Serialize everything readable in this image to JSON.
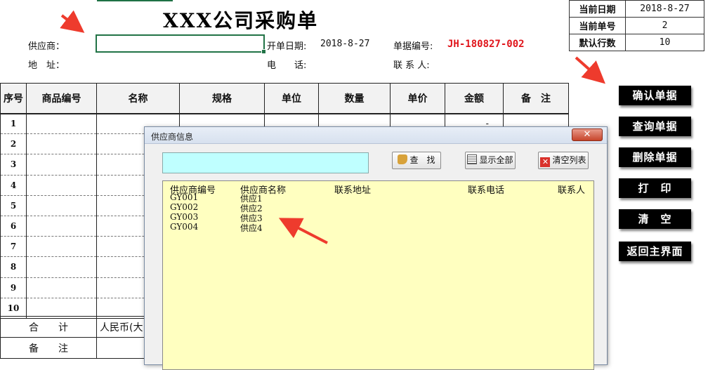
{
  "title": "XXX公司采购单",
  "header": {
    "supplier_label": "供应商：",
    "address_label": "地　址：",
    "open_date_label": "开单日期:",
    "open_date_value": "2018-8-27",
    "order_no_label": "单据编号:",
    "order_no_value": "JH-180827-002",
    "phone_label": "电　　话:",
    "contact_label": "联 系 人:"
  },
  "info_box": [
    {
      "key": "当前日期",
      "value": "2018-8-27"
    },
    {
      "key": "当前单号",
      "value": "2"
    },
    {
      "key": "默认行数",
      "value": "10"
    }
  ],
  "table": {
    "headers": [
      "序号",
      "商品编号",
      "名称",
      "规格",
      "单位",
      "数量",
      "单价",
      "金额",
      "备　注"
    ],
    "rows": [
      "1",
      "2",
      "3",
      "4",
      "5",
      "6",
      "7",
      "8",
      "9",
      "10"
    ],
    "first_amount": "-",
    "total_label": "合　　计",
    "total_value": "人民币(大",
    "remark_label": "备　　注"
  },
  "buttons": [
    "确认单据",
    "查询单据",
    "删除单据",
    "打　印",
    "清　空",
    "返回主界面"
  ],
  "dialog": {
    "title": "供应商信息",
    "search_button": "查　找",
    "show_all_button": "显示全部",
    "clear_list_button": "清空列表",
    "columns": [
      "供应商编号",
      "供应商名称",
      "联系地址",
      "联系电话",
      "联系人"
    ],
    "rows": [
      {
        "code": "GY001",
        "name": "供应1"
      },
      {
        "code": "GY002",
        "name": "供应2"
      },
      {
        "code": "GY003",
        "name": "供应3"
      },
      {
        "code": "GY004",
        "name": "供应4"
      }
    ]
  },
  "colors": {
    "accent_green": "#217346",
    "order_no_red": "#e0151b",
    "list_bg": "#ffffc0",
    "search_bg": "#bfffff",
    "arrow_red": "#ee3b2d"
  }
}
